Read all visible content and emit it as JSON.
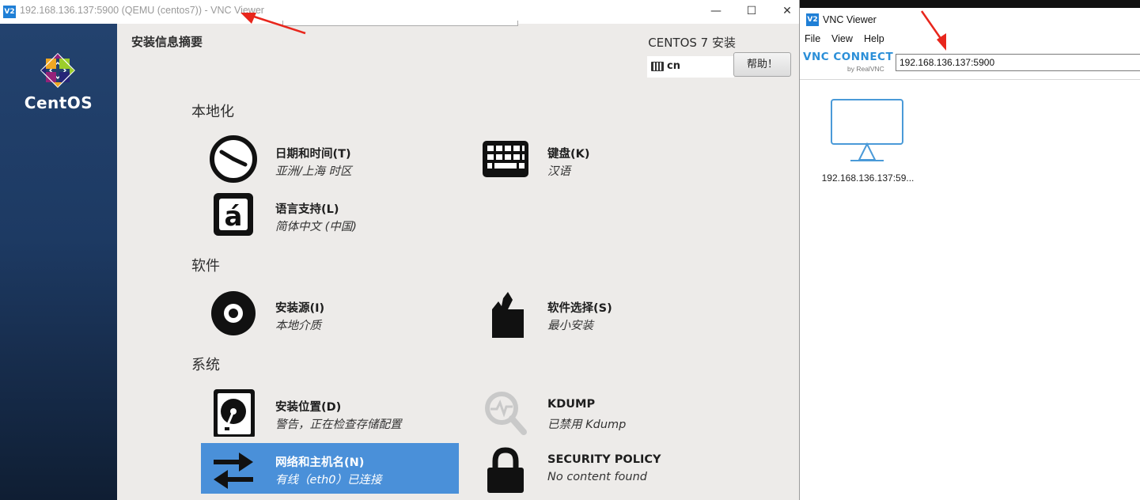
{
  "left_window": {
    "title": "192.168.136.137:5900 (QEMU (centos7)) - VNC Viewer",
    "app_icon": "V2",
    "controls": {
      "minimize": "—",
      "maximize": "☐",
      "close": "✕"
    }
  },
  "sidebar": {
    "brand": "CentOS"
  },
  "installer": {
    "summary_title": "安装信息摘要",
    "product_title": "CENTOS 7 安装",
    "keyboard_layout": "cn",
    "help_label": "帮助！",
    "sections": {
      "localization": "本地化",
      "software": "软件",
      "system": "系统"
    },
    "spokes": {
      "datetime": {
        "title": "日期和时间(T)",
        "status": "亚洲/上海 时区",
        "icon": "clock-icon"
      },
      "keyboard": {
        "title": "键盘(K)",
        "status": "汉语",
        "icon": "keyboard-icon"
      },
      "language": {
        "title": "语言支持(L)",
        "status": "简体中文 (中国)",
        "icon": "language-icon",
        "glyph": "á"
      },
      "source": {
        "title": "安装源(I)",
        "status": "本地介质",
        "icon": "disc-icon"
      },
      "software_selection": {
        "title": "软件选择(S)",
        "status": "最小安装",
        "icon": "package-icon"
      },
      "destination": {
        "title": "安装位置(D)",
        "status": "警告，正在检查存储配置",
        "icon": "harddisk-icon"
      },
      "kdump": {
        "title": "KDUMP",
        "status": "已禁用 Kdump",
        "icon": "magnifier-icon"
      },
      "network": {
        "title": "网络和主机名(N)",
        "status": "有线（eth0）已连接",
        "icon": "network-arrows-icon"
      },
      "security": {
        "title": "SECURITY POLICY",
        "status": "No content found",
        "icon": "lock-icon"
      }
    }
  },
  "right_window": {
    "title": "VNC Viewer",
    "app_icon": "V2",
    "menu": [
      "File",
      "View",
      "Help"
    ],
    "logo_text": "VNC CONNECT",
    "logo_sub": "by RealVNC",
    "address_value": "192.168.136.137:5900",
    "connection_label": "192.168.136.137:59..."
  },
  "colors": {
    "selected_spoke": "#4a90d9",
    "annotation_arrow": "#e8261c",
    "vnc_blue": "#2b8fd8"
  }
}
